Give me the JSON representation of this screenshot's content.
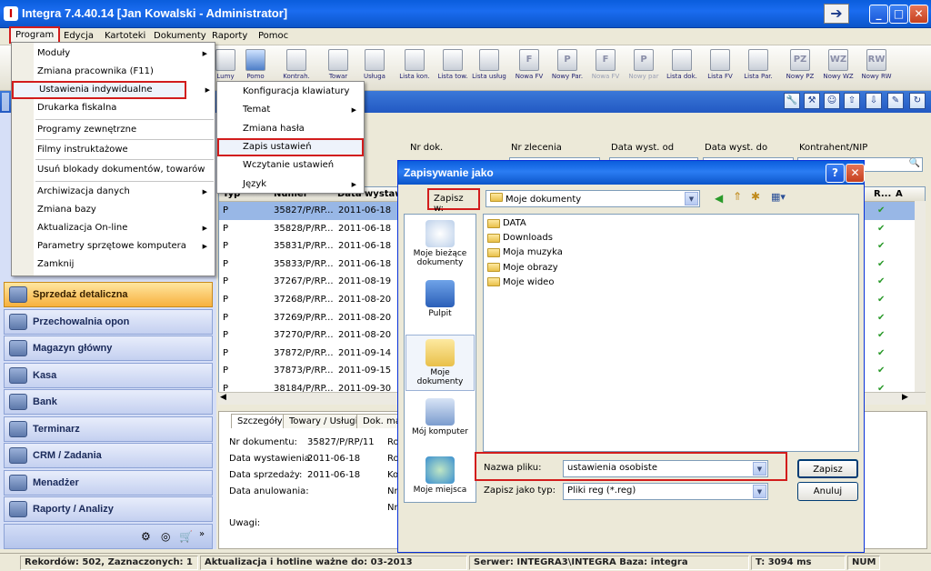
{
  "window": {
    "title": "Integra 7.4.40.14  [Jan Kowalski - Administrator]",
    "app_icon_letter": "I"
  },
  "menubar": {
    "items": [
      "Program",
      "Edycja",
      "Kartoteki",
      "Dokumenty",
      "Raporty",
      "Pomoc"
    ]
  },
  "toolbar": {
    "buttons": [
      {
        "label": "Kontrah.",
        "icon": "person-icon"
      },
      {
        "label": "Towar",
        "icon": "box-icon"
      },
      {
        "label": "Usługa",
        "icon": "tools-icon"
      },
      {
        "label": "Lista kon.",
        "icon": "list-contractors-icon"
      },
      {
        "label": "Lista tow.",
        "icon": "list-goods-icon"
      },
      {
        "label": "Lista usług",
        "icon": "list-services-icon"
      },
      {
        "label": "Nowa FV",
        "icon": "document-icon",
        "letter": "F"
      },
      {
        "label": "Nowy Par.",
        "icon": "document-icon",
        "letter": "P"
      },
      {
        "label": "Nowa FV",
        "icon": "document-icon",
        "letter": "F",
        "dim": true
      },
      {
        "label": "Nowy par",
        "icon": "document-icon",
        "letter": "P",
        "dim": true
      },
      {
        "label": "Lista dok.",
        "icon": "list-icon"
      },
      {
        "label": "Lista FV",
        "icon": "list-fv-icon"
      },
      {
        "label": "Lista Par.",
        "icon": "list-par-icon"
      },
      {
        "label": "Nowy PZ",
        "icon": "document-icon",
        "letter": "PZ"
      },
      {
        "label": "Nowy WZ",
        "icon": "document-icon",
        "letter": "WZ"
      },
      {
        "label": "Nowy RW",
        "icon": "document-icon",
        "letter": "RW"
      }
    ],
    "hidden_labels": [
      "Lumy",
      "Pomo"
    ]
  },
  "program_menu": {
    "items": [
      {
        "label": "Moduły",
        "submenu": true
      },
      {
        "label": "Zmiana pracownika (F11)"
      },
      {
        "label": "Ustawienia indywidualne",
        "submenu": true,
        "highlighted": true
      },
      {
        "label": "Drukarka fiskalna"
      },
      {
        "label": "Programy zewnętrzne"
      },
      {
        "label": "Filmy instruktażowe"
      },
      {
        "label": "Usuń blokady dokumentów, towarów"
      },
      {
        "label": "Archiwizacja danych",
        "submenu": true
      },
      {
        "label": "Zmiana bazy"
      },
      {
        "label": "Aktualizacja On-line",
        "submenu": true
      },
      {
        "label": "Parametry sprzętowe komputera",
        "submenu": true
      },
      {
        "label": "Zamknij"
      }
    ]
  },
  "settings_submenu": {
    "items": [
      {
        "label": "Konfiguracja klawiatury"
      },
      {
        "label": "Temat",
        "submenu": true
      },
      {
        "label": "Zmiana hasła"
      },
      {
        "label": "Zapis ustawień",
        "highlighted": true
      },
      {
        "label": "Wczytanie ustawień"
      },
      {
        "label": "Język",
        "submenu": true
      }
    ]
  },
  "nav": {
    "items": [
      {
        "label": "Sprzedaż detaliczna",
        "selected": true
      },
      {
        "label": "Przechowalnia opon"
      },
      {
        "label": "Magazyn główny"
      },
      {
        "label": "Kasa"
      },
      {
        "label": "Bank"
      },
      {
        "label": "Terminarz"
      },
      {
        "label": "CRM / Zadania"
      },
      {
        "label": "Menadżer"
      },
      {
        "label": "Raporty / Analizy"
      }
    ]
  },
  "filters": {
    "labels": [
      "Nr dok.",
      "Nr zlecenia",
      "Data wyst. od",
      "Data wyst. do",
      "Kontrahent/NIP"
    ]
  },
  "grid": {
    "headers": [
      "Typ",
      "Numer",
      "Data wystaw",
      "R...",
      "A"
    ],
    "rows": [
      {
        "typ": "P",
        "numer": "35827/P/RP...",
        "data": "2011-06-18",
        "ok": "✔"
      },
      {
        "typ": "P",
        "numer": "35828/P/RP...",
        "data": "2011-06-18",
        "ok": "✔"
      },
      {
        "typ": "P",
        "numer": "35831/P/RP...",
        "data": "2011-06-18",
        "ok": "✔"
      },
      {
        "typ": "P",
        "numer": "35833/P/RP...",
        "data": "2011-06-18",
        "ok": "✔"
      },
      {
        "typ": "P",
        "numer": "37267/P/RP...",
        "data": "2011-08-19",
        "ok": "✔"
      },
      {
        "typ": "P",
        "numer": "37268/P/RP...",
        "data": "2011-08-20",
        "ok": "✔"
      },
      {
        "typ": "P",
        "numer": "37269/P/RP...",
        "data": "2011-08-20",
        "ok": "✔"
      },
      {
        "typ": "P",
        "numer": "37270/P/RP...",
        "data": "2011-08-20",
        "ok": "✔"
      },
      {
        "typ": "P",
        "numer": "37872/P/RP...",
        "data": "2011-09-14",
        "ok": "✔"
      },
      {
        "typ": "P",
        "numer": "37873/P/RP...",
        "data": "2011-09-15",
        "ok": "✔"
      },
      {
        "typ": "P",
        "numer": "38184/P/RP...",
        "data": "2011-09-30",
        "ok": "✔"
      }
    ]
  },
  "details": {
    "tabs": [
      "Szczegóły",
      "Towary / Usługi",
      "Dok. mag"
    ],
    "fields": [
      {
        "label": "Nr dokumentu:",
        "value": "35827/P/RP/11"
      },
      {
        "label": "Data wystawienia:",
        "value": "2011-06-18"
      },
      {
        "label": "Data sprzedaży:",
        "value": "2011-06-18"
      },
      {
        "label": "Data anulowania:",
        "value": ""
      },
      {
        "label": "Uwagi:",
        "value": ""
      }
    ],
    "col2_labels": [
      "Ro",
      "Ro",
      "Ko",
      "Nr",
      "Nr"
    ]
  },
  "dialog": {
    "title": "Zapisywanie jako",
    "save_in_label": "Zapisz w:",
    "save_in_value": "Moje dokumenty",
    "places": [
      "Moje bieżące dokumenty",
      "Pulpit",
      "Moje dokumenty",
      "Mój komputer",
      "Moje miejsca"
    ],
    "files": [
      "DATA",
      "Downloads",
      "Moja muzyka",
      "Moje obrazy",
      "Moje wideo"
    ],
    "filename_label": "Nazwa pliku:",
    "filename_value": "ustawienia osobiste",
    "filetype_label": "Zapisz jako typ:",
    "filetype_value": "Pliki reg (*.reg)",
    "save_button": "Zapisz",
    "cancel_button": "Anuluj",
    "help_button": "?",
    "close_button": "✕"
  },
  "statusbar": {
    "records": "Rekordów: 502, Zaznaczonych: 1",
    "update": "Aktualizacja i hotline ważne do: 03-2013",
    "server": "Serwer: INTEGRA3\\INTEGRA  Baza: integra",
    "time": "T: 3094 ms",
    "num": "NUM"
  },
  "colors": {
    "titlebar": "#0a5ddc",
    "highlight_red": "#d21c1c",
    "selected_row": "#98b7e6",
    "nav_selected": "#f7b13e"
  }
}
